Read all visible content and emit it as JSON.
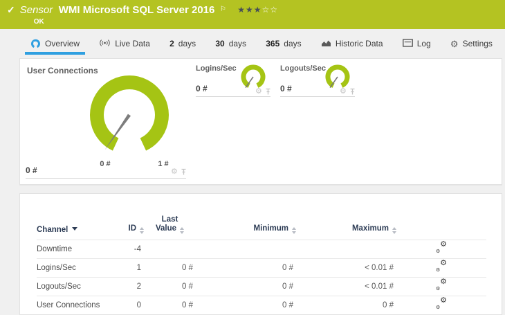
{
  "header": {
    "kind": "Sensor",
    "title": "WMI Microsoft SQL Server 2016",
    "status": "OK",
    "stars_filled": "★★★",
    "stars_empty": "☆☆"
  },
  "tabs": {
    "overview": "Overview",
    "live_data": "Live Data",
    "d2_num": "2",
    "d2_text": "days",
    "d30_num": "30",
    "d30_text": "days",
    "d365_num": "365",
    "d365_text": "days",
    "historic": "Historic Data",
    "log": "Log",
    "settings": "Settings"
  },
  "gauges": {
    "main": {
      "title": "User Connections",
      "value": "0 #",
      "scale_min": "0 #",
      "scale_max": "1 #"
    },
    "logins": {
      "title": "Logins/Sec",
      "value": "0 #"
    },
    "logouts": {
      "title": "Logouts/Sec",
      "value": "0 #"
    }
  },
  "table": {
    "col_channel": "Channel",
    "col_id": "ID",
    "col_last_value": "Last Value",
    "col_minimum": "Minimum",
    "col_maximum": "Maximum",
    "rows": [
      {
        "channel": "Downtime",
        "id": "-4",
        "last": "",
        "min": "",
        "max": ""
      },
      {
        "channel": "Logins/Sec",
        "id": "1",
        "last": "0 #",
        "min": "0 #",
        "max": "< 0.01 #"
      },
      {
        "channel": "Logouts/Sec",
        "id": "2",
        "last": "0 #",
        "min": "0 #",
        "max": "< 0.01 #"
      },
      {
        "channel": "User Connections",
        "id": "0",
        "last": "0 #",
        "min": "0 #",
        "max": "0 #"
      }
    ]
  },
  "icons": {
    "status": "check-icon",
    "overview": "gauge-icon",
    "live_data": "broadcast-icon",
    "historic": "area-chart-icon",
    "log": "log-window-icon",
    "settings": "gear-icon",
    "row_settings": "double-gear-icon",
    "pin": "pin-icon",
    "sort": "sort-arrows-icon"
  },
  "colors": {
    "header_green": "#b4c322",
    "gauge_green": "#a5c414",
    "accent_blue": "#2f9fe0",
    "table_header_navy": "#2d3c55",
    "star_filled": "#474f56"
  }
}
